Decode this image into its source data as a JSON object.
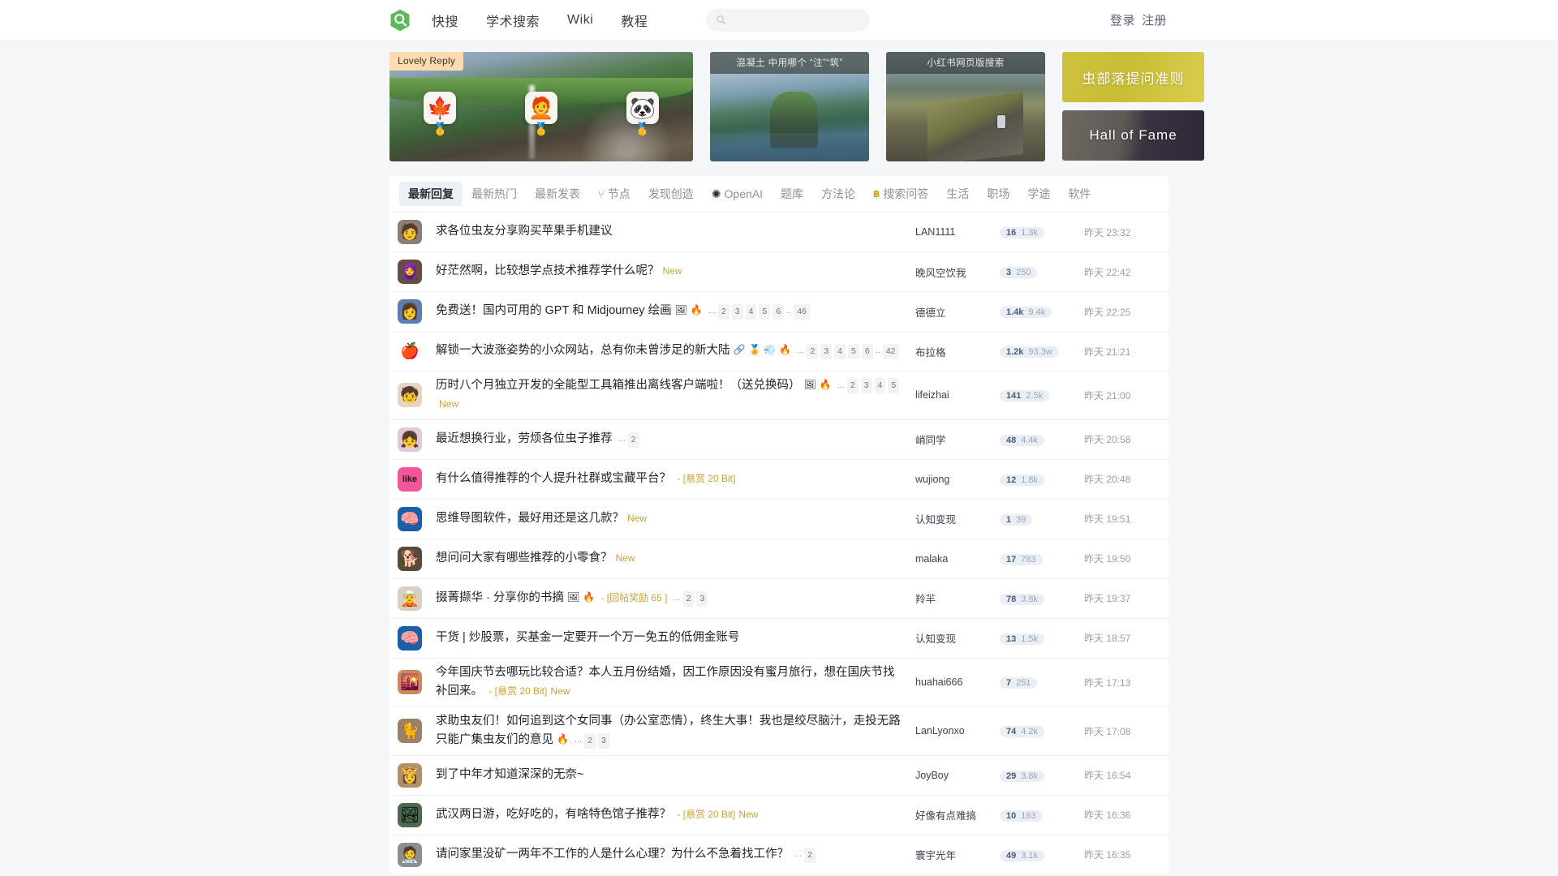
{
  "header": {
    "logo_icon": "search-logo-icon",
    "nav": [
      {
        "label": "快搜"
      },
      {
        "label": "学术搜索"
      },
      {
        "label": "Wiki"
      },
      {
        "label": "教程"
      }
    ],
    "search": {
      "value": "",
      "placeholder": "",
      "icon": "search-icon"
    },
    "auth": [
      {
        "label": "登录"
      },
      {
        "label": "注册"
      }
    ]
  },
  "banners": [
    {
      "type": "large",
      "tag": "Lovely Reply",
      "caption": "",
      "avatars": [
        {
          "emoji": "🍁",
          "medal": "🥇"
        },
        {
          "emoji": "🧑‍🦰",
          "medal": "🥇"
        },
        {
          "emoji": "🐼",
          "medal": "🥇"
        }
      ]
    },
    {
      "type": "medium",
      "caption": "混凝土 中用哪个 “注”“筑”",
      "tag": "",
      "avatars": []
    },
    {
      "type": "medium",
      "caption": "小红书网页版搜索",
      "tag": "",
      "avatars": []
    }
  ],
  "banner_buttons": [
    {
      "label": "虫部落提问准则",
      "style": "rules",
      "color": "#cfc33d"
    },
    {
      "label": "Hall of Fame",
      "style": "hof",
      "color": "#3a3240"
    }
  ],
  "tabs": [
    {
      "label": "最新回复",
      "active": true,
      "icon": ""
    },
    {
      "label": "最新热门",
      "active": false,
      "icon": ""
    },
    {
      "label": "最新发表",
      "active": false,
      "icon": ""
    },
    {
      "label": "节点",
      "active": false,
      "icon": "node-icon"
    },
    {
      "label": "发现创造",
      "active": false,
      "icon": ""
    },
    {
      "label": "OpenAI",
      "active": false,
      "icon": "openai-icon"
    },
    {
      "label": "题库",
      "active": false,
      "icon": ""
    },
    {
      "label": "方法论",
      "active": false,
      "icon": ""
    },
    {
      "label": "搜索问答",
      "active": false,
      "icon": "bit-icon"
    },
    {
      "label": "生活",
      "active": false,
      "icon": ""
    },
    {
      "label": "职场",
      "active": false,
      "icon": ""
    },
    {
      "label": "学途",
      "active": false,
      "icon": ""
    },
    {
      "label": "软件",
      "active": false,
      "icon": ""
    }
  ],
  "posts": [
    {
      "avatar": "🧑",
      "avatar_bg": "#8a7f74",
      "title": "求各位虫友分享购买苹果手机建议",
      "new": false,
      "bounty": "",
      "icons": [],
      "pages": [],
      "author": "LAN1111",
      "replies": "16",
      "views": "1.3k",
      "time": "昨天 23:32"
    },
    {
      "avatar": "🧕",
      "avatar_bg": "#6b4a4a",
      "title": "好茫然啊，比较想学点技术推荐学什么呢？",
      "new": true,
      "bounty": "",
      "icons": [],
      "pages": [],
      "author": "晚风空饮我",
      "replies": "3",
      "views": "250",
      "time": "昨天 22:42"
    },
    {
      "avatar": "👩",
      "avatar_bg": "#5b7fb0",
      "title": "免费送！国内可用的 GPT 和 Midjourney 绘画",
      "new": false,
      "bounty": "",
      "icons": [
        "🖼",
        "🔥"
      ],
      "pages": [
        "2",
        "3",
        "4",
        "5",
        "6",
        "..",
        "46"
      ],
      "author": "德德立",
      "replies": "1.4k",
      "views": "9.4k",
      "time": "昨天 22:25"
    },
    {
      "avatar": "🍎",
      "avatar_bg": "#ffffff",
      "title": "解锁一大波涨姿势的小众网站，总有你未曾涉足的新大陆",
      "new": false,
      "bounty": "",
      "icons": [
        "🔗",
        "🏅",
        "💨",
        "🔥"
      ],
      "pages": [
        "2",
        "3",
        "4",
        "5",
        "6",
        "..",
        "42"
      ],
      "author": "布拉格",
      "replies": "1.2k",
      "views": "93.3w",
      "time": "昨天 21:21"
    },
    {
      "avatar": "🧒",
      "avatar_bg": "#e8d5c0",
      "title": "历时八个月独立开发的全能型工具箱推出离线客户端啦！（送兑换码）",
      "new": true,
      "bounty": "",
      "icons": [
        "🖼",
        "🔥"
      ],
      "pages": [
        "2",
        "3",
        "4",
        "5"
      ],
      "author": "lifeizhai",
      "replies": "141",
      "views": "2.5k",
      "time": "昨天 21:00"
    },
    {
      "avatar": "👧",
      "avatar_bg": "#e2c8d8",
      "title": "最近想换行业，劳烦各位虫子推荐",
      "new": false,
      "bounty": "",
      "icons": [],
      "pages": [
        "2"
      ],
      "author": "峭同学",
      "replies": "48",
      "views": "4.4k",
      "time": "昨天 20:58"
    },
    {
      "avatar": "like",
      "avatar_bg": "#f4569b",
      "title": "有什么值得推荐的个人提升社群或宝藏平台？",
      "new": false,
      "bounty": "[悬赏 20 Bit]",
      "icons": [],
      "pages": [],
      "author": "wujiong",
      "replies": "12",
      "views": "1.8k",
      "time": "昨天 20:48"
    },
    {
      "avatar": "🧠",
      "avatar_bg": "#1b5fa8",
      "title": "思维导图软件，最好用还是这几款？",
      "new": true,
      "bounty": "",
      "icons": [],
      "pages": [],
      "author": "认知变现",
      "replies": "1",
      "views": "39",
      "time": "昨天 19:51"
    },
    {
      "avatar": "🐕",
      "avatar_bg": "#5b4a38",
      "title": "想问问大家有哪些推荐的小零食？",
      "new": true,
      "bounty": "",
      "icons": [],
      "pages": [],
      "author": "malaka",
      "replies": "17",
      "views": "783",
      "time": "昨天 19:50"
    },
    {
      "avatar": "🧝",
      "avatar_bg": "#d8cfc2",
      "title": "掇菁撷华 · 分享你的书摘",
      "new": false,
      "bounty": "[回帖奖励 65 ]",
      "icons": [
        "🖼",
        "🔥"
      ],
      "pages": [
        "2",
        "3"
      ],
      "author": "羚羋",
      "replies": "78",
      "views": "3.8k",
      "time": "昨天 19:37"
    },
    {
      "avatar": "🧠",
      "avatar_bg": "#1b5fa8",
      "title": "干货 | 炒股票，买基金一定要开一个万一免五的低佣金账号",
      "new": false,
      "bounty": "",
      "icons": [],
      "pages": [],
      "author": "认知变现",
      "replies": "13",
      "views": "1.5k",
      "time": "昨天 18:57"
    },
    {
      "avatar": "🌇",
      "avatar_bg": "#c98a5e",
      "title": "今年国庆节去哪玩比较合适？本人五月份结婚，因工作原因没有蜜月旅行，想在国庆节找补回来。",
      "new": true,
      "bounty": "[悬赏 20 Bit]",
      "icons": [],
      "pages": [],
      "author": "huahai666",
      "replies": "7",
      "views": "251",
      "time": "昨天 17:13"
    },
    {
      "avatar": "🐈",
      "avatar_bg": "#9a8268",
      "title": "求助虫友们！如何追到这个女同事（办公室恋情），终生大事！我也是绞尽脑汁，走投无路只能广集虫友们的意见",
      "new": false,
      "bounty": "",
      "icons": [
        "🔥"
      ],
      "pages": [
        "2",
        "3"
      ],
      "author": "LanLyonxo",
      "replies": "74",
      "views": "4.2k",
      "time": "昨天 17:08"
    },
    {
      "avatar": "👸",
      "avatar_bg": "#b08f6a",
      "title": "到了中年才知道深深的无奈~",
      "new": false,
      "bounty": "",
      "icons": [],
      "pages": [],
      "author": "JoyBoy",
      "replies": "29",
      "views": "3.8k",
      "time": "昨天 16:54"
    },
    {
      "avatar": "🏞",
      "avatar_bg": "#4a6a52",
      "title": "武汉两日游，吃好吃的，有啥特色馆子推荐？",
      "new": true,
      "bounty": "[悬赏 20 Bit]",
      "icons": [],
      "pages": [],
      "author": "好像有点难搞",
      "replies": "10",
      "views": "163",
      "time": "昨天 16:36"
    },
    {
      "avatar": "🧑‍⚕️",
      "avatar_bg": "#8e8e92",
      "title": "请问家里没矿一两年不工作的人是什么心理？为什么不急着找工作？",
      "new": false,
      "bounty": "",
      "icons": [],
      "pages": [
        "2"
      ],
      "author": "寰宇光年",
      "replies": "49",
      "views": "3.1k",
      "time": "昨天 16:35"
    }
  ]
}
